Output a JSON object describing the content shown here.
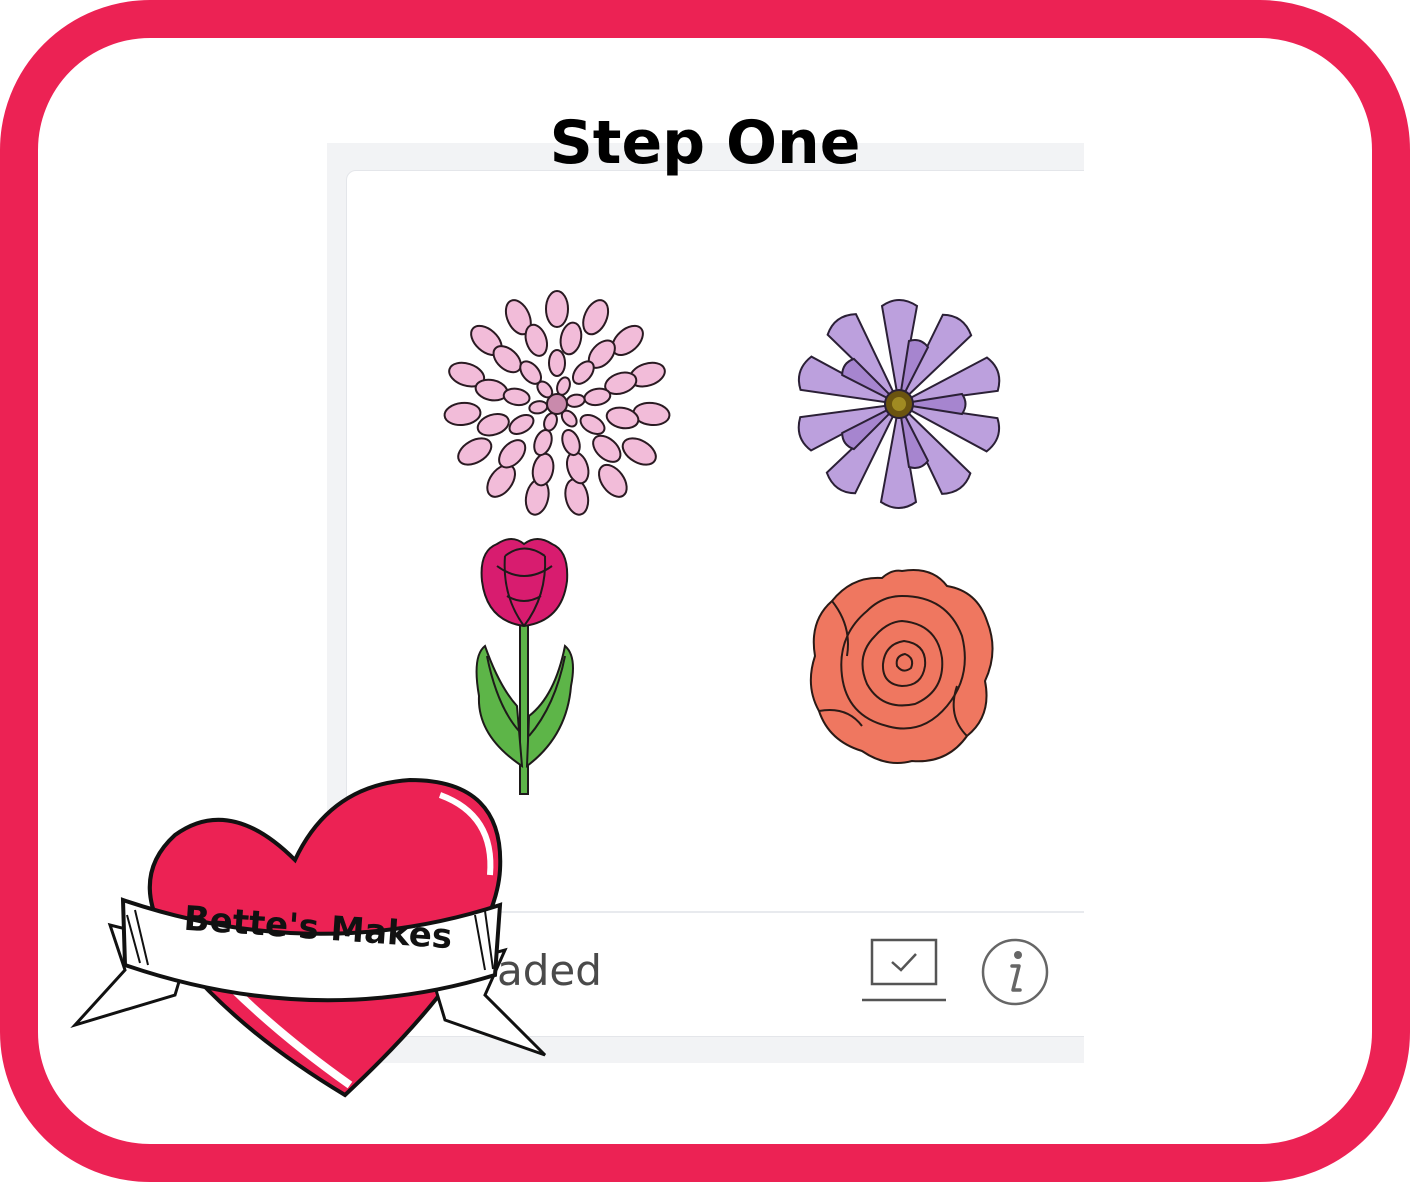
{
  "title": "Step One",
  "card": {
    "footer_label": "aded",
    "icons": [
      "monitor-check-icon",
      "info-icon"
    ]
  },
  "flowers": [
    "pink-dahlia",
    "purple-daisy",
    "magenta-tulip",
    "coral-rose"
  ],
  "logo": {
    "text": "Bette's Makes"
  },
  "colors": {
    "frame": "#ec2254",
    "dahlia": "#f2bcd9",
    "daisy": "#bca0dd",
    "tulip": "#d81c6f",
    "leaf": "#5db548",
    "rose": "#ef7760"
  }
}
